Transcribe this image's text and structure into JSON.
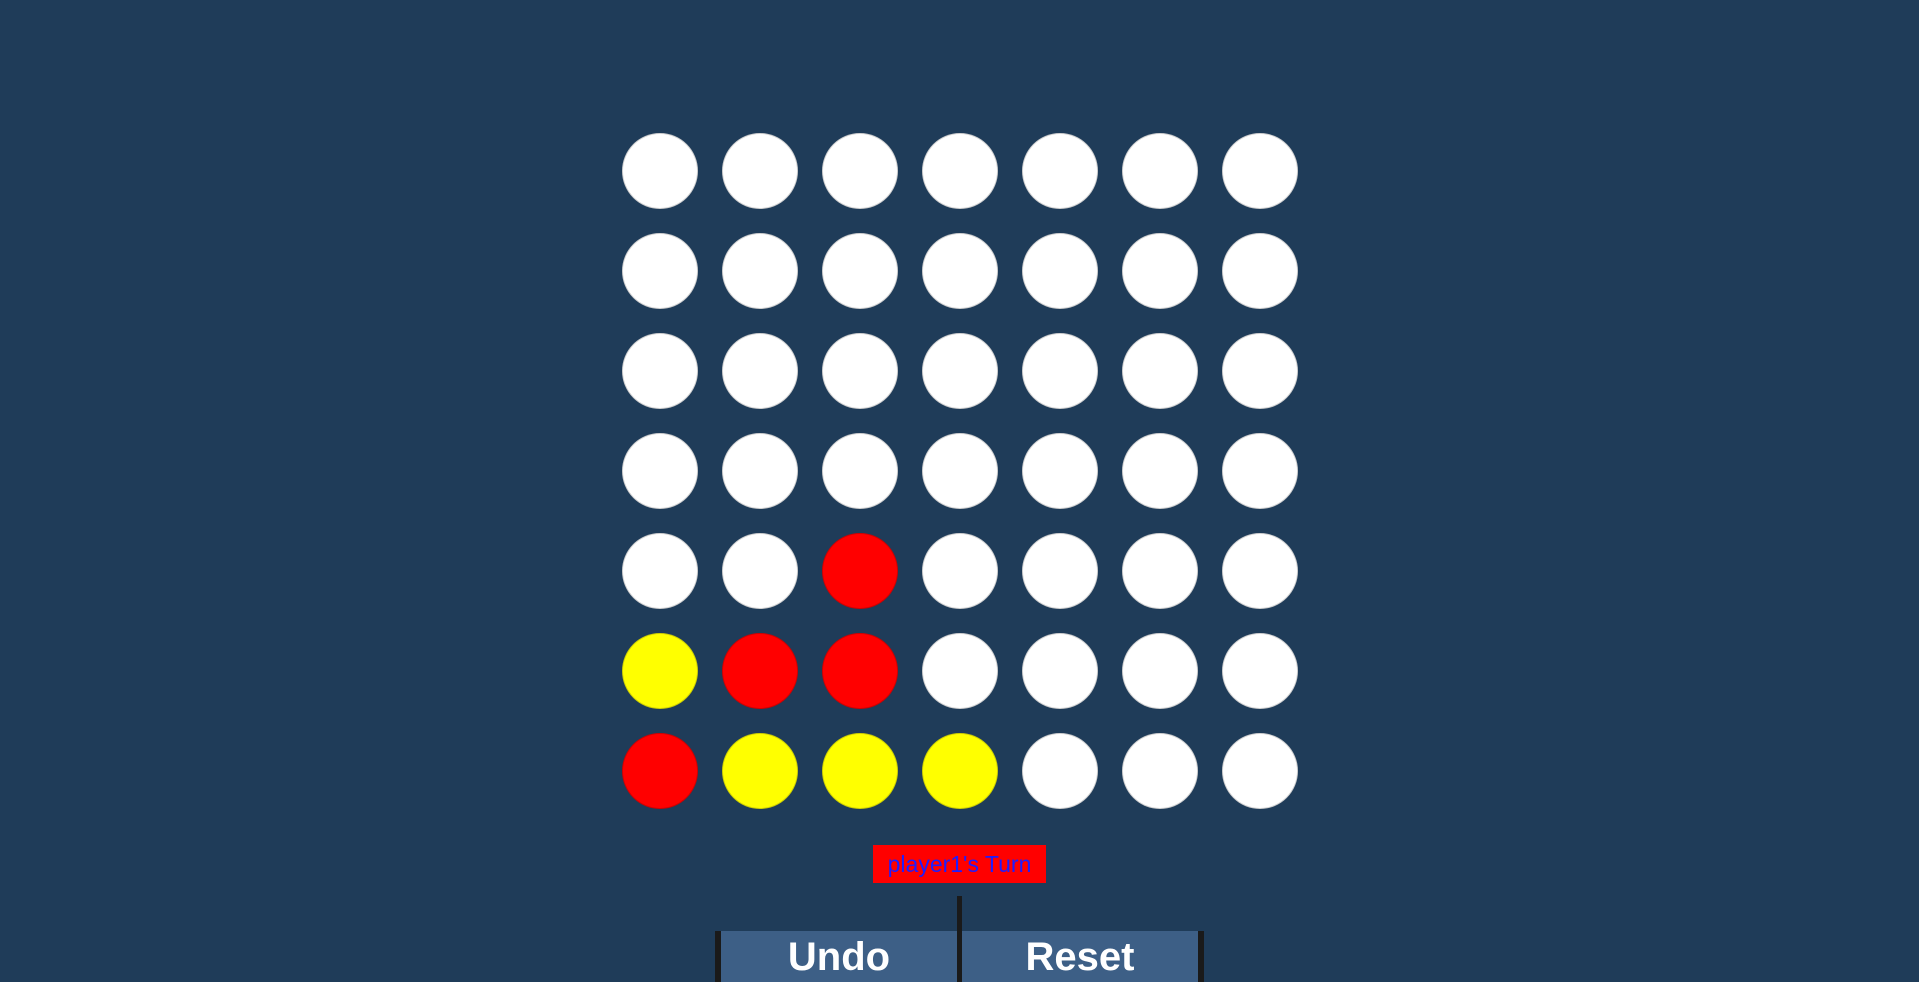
{
  "colors": {
    "background": "#1f3c59",
    "empty": "#ffffff",
    "red": "#ff0000",
    "yellow": "#ffff00",
    "status_bg": "#ff0000",
    "status_text": "#1e1eff",
    "button_bg": "#3d5f86"
  },
  "board": {
    "rows": 7,
    "cols": 7,
    "cells": [
      [
        "empty",
        "empty",
        "empty",
        "empty",
        "empty",
        "empty",
        "empty"
      ],
      [
        "empty",
        "empty",
        "empty",
        "empty",
        "empty",
        "empty",
        "empty"
      ],
      [
        "empty",
        "empty",
        "empty",
        "empty",
        "empty",
        "empty",
        "empty"
      ],
      [
        "empty",
        "empty",
        "empty",
        "empty",
        "empty",
        "empty",
        "empty"
      ],
      [
        "empty",
        "empty",
        "red",
        "empty",
        "empty",
        "empty",
        "empty"
      ],
      [
        "yellow",
        "red",
        "red",
        "empty",
        "empty",
        "empty",
        "empty"
      ],
      [
        "red",
        "yellow",
        "yellow",
        "yellow",
        "empty",
        "empty",
        "empty"
      ]
    ]
  },
  "status": {
    "turn_text": "player1's Turn"
  },
  "controls": {
    "undo_label": "Undo",
    "reset_label": "Reset"
  }
}
